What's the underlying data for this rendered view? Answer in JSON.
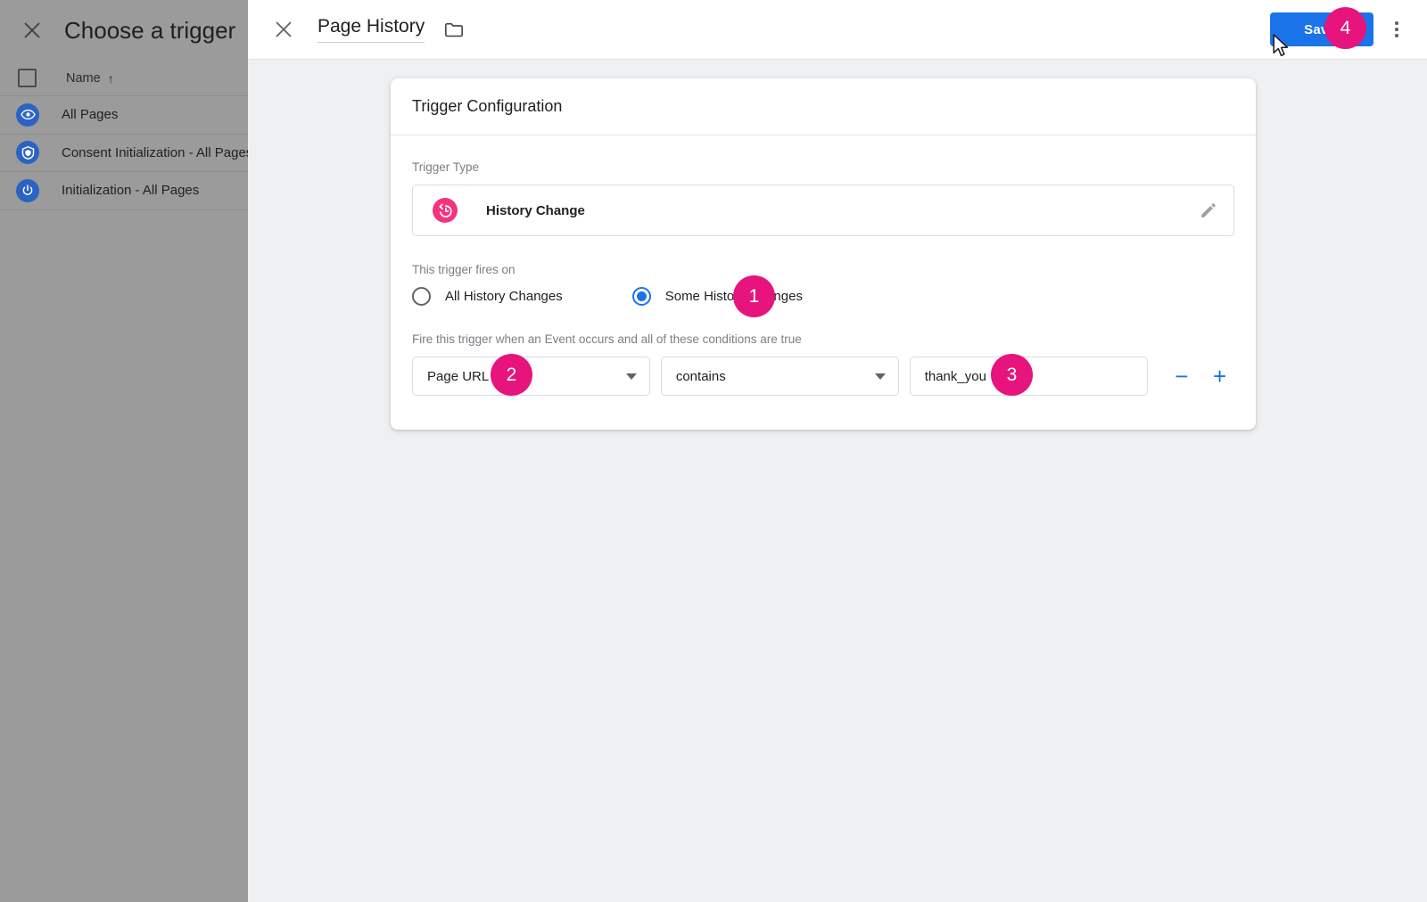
{
  "trigger_picker": {
    "title": "Choose a trigger",
    "close_icon": "close-icon",
    "column_header": {
      "name": "Name",
      "sort_arrow": "↑"
    },
    "rows": [
      {
        "icon": "eye-icon",
        "label": "All Pages"
      },
      {
        "icon": "shield-icon",
        "label": "Consent Initialization - All Pages"
      },
      {
        "icon": "power-icon",
        "label": "Initialization - All Pages"
      }
    ]
  },
  "workspace": {
    "close_icon": "close-icon",
    "title": "Page History",
    "folder_icon": "folder-icon",
    "save_label": "Save",
    "more_icon": "more-vertical-icon",
    "accent_blue": "#1a73e8"
  },
  "card": {
    "heading": "Trigger Configuration",
    "trigger_type": {
      "label": "Trigger Type",
      "icon": "history-change-icon",
      "icon_color": "#f5337f",
      "name": "History Change",
      "edit_icon": "pencil-icon"
    },
    "fires_on": {
      "label": "This trigger fires on",
      "options": [
        {
          "label": "All History Changes",
          "selected": false
        },
        {
          "label": "Some History Changes",
          "selected": true
        }
      ]
    },
    "conditions": {
      "help": "Fire this trigger when an Event occurs and all of these conditions are true",
      "rows": [
        {
          "variable": "Page URL",
          "operator": "contains",
          "value": "thank_you",
          "value_placeholder": "",
          "remove_label": "−",
          "add_label": "+"
        }
      ]
    }
  },
  "annotations": {
    "badge_color": "#e6147c",
    "steps": [
      {
        "n": "1",
        "target": "some-history-changes-radio"
      },
      {
        "n": "2",
        "target": "condition-variable-select"
      },
      {
        "n": "3",
        "target": "condition-value-input"
      },
      {
        "n": "4",
        "target": "save-button"
      }
    ]
  }
}
